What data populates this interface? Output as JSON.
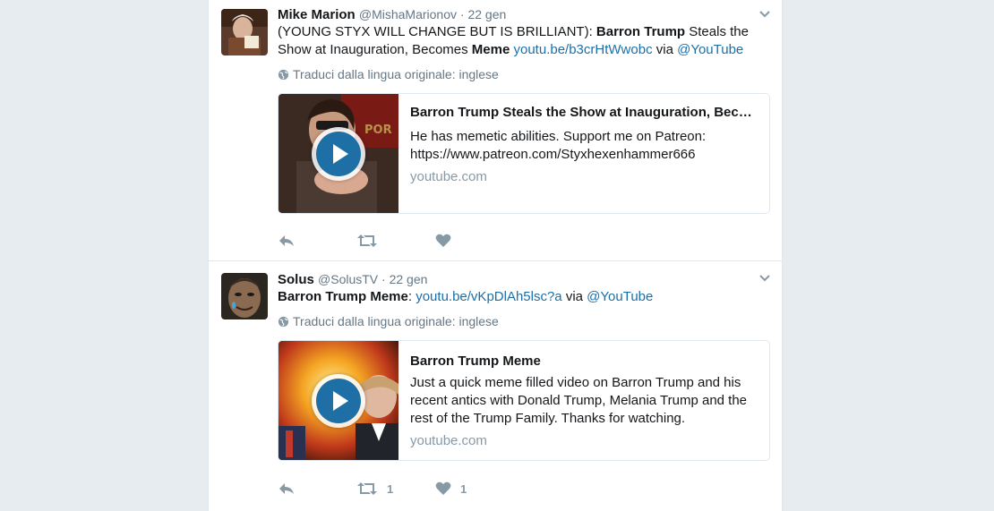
{
  "tweets": [
    {
      "name": "Mike Marion",
      "handle": "@MishaMarionov",
      "sep": " · ",
      "date": "22 gen",
      "text": {
        "p1": "(YOUNG STYX WILL CHANGE BUT IS BRILLIANT): ",
        "b1": "Barron Trump",
        "p2": " Steals the Show at Inauguration, Becomes ",
        "b2": "Meme",
        "p3": " ",
        "link": "youtu.be/b3crHtWwobc",
        "via": " via ",
        "mention": "@YouTube"
      },
      "translate": "Traduci dalla lingua originale: inglese",
      "card": {
        "title": "Barron Trump Steals the Show at Inauguration, Bec…",
        "desc": "He has memetic abilities. Support me on Patreon: https://www.patreon.com/Styxhexenhammer666",
        "domain": "youtube.com"
      },
      "actions": {
        "reply_icon": "reply-icon",
        "retweet_icon": "retweet-icon",
        "like_icon": "heart-icon",
        "retweets": "",
        "likes": ""
      }
    },
    {
      "name": "Solus",
      "handle": "@SolusTV",
      "sep": " · ",
      "date": "22 gen",
      "text": {
        "b1": "Barron Trump Meme",
        "p1": ": ",
        "link": "youtu.be/vKpDlAh5lsc?a",
        "via": " via ",
        "mention": "@YouTube"
      },
      "translate": "Traduci dalla lingua originale: inglese",
      "card": {
        "title": "Barron Trump Meme",
        "desc": "Just a quick meme filled video on Barron Trump and his recent antics with Donald Trump, Melania Trump and the rest of the Trump Family. Thanks for watching.",
        "domain": "youtube.com"
      },
      "actions": {
        "reply_icon": "reply-icon",
        "retweet_icon": "retweet-icon",
        "like_icon": "heart-icon",
        "retweets": "1",
        "likes": "1"
      }
    }
  ],
  "colors": {
    "link": "#1b6fa8",
    "muted": "#657786",
    "icon": "#8899a6",
    "play": "#1d6fa5"
  }
}
